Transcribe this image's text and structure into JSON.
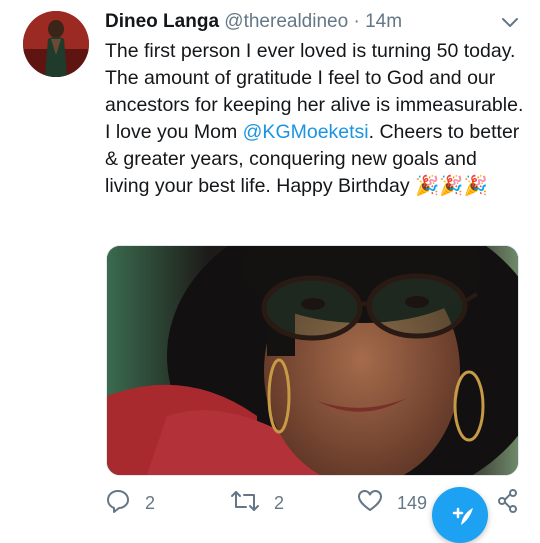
{
  "tweet": {
    "author_name": "Dineo Langa",
    "author_handle": "@therealdineo",
    "separator": "·",
    "timestamp": "14m",
    "text_before_mention": "The first person I ever loved is turning 50 today. The amount of gratitude I feel to God and our ancestors for keeping her alive is immeasurable. I love you Mom ",
    "mention": "@KGMoeketsi",
    "text_after_mention": ". Cheers to better & greater years, conquering new goals and living your best life. Happy Birthday ",
    "emoji": "🎉🎉🎉",
    "media_icon": "photo",
    "stats": {
      "replies": "2",
      "retweets": "2",
      "likes": "149"
    }
  },
  "icons": {
    "more": "chevron-down-icon",
    "reply": "reply-icon",
    "retweet": "retweet-icon",
    "like": "heart-icon",
    "share": "share-icon",
    "compose": "compose-tweet-icon"
  },
  "colors": {
    "link": "#1b95e0",
    "secondary_text": "#657786",
    "fab": "#1da1f2"
  }
}
